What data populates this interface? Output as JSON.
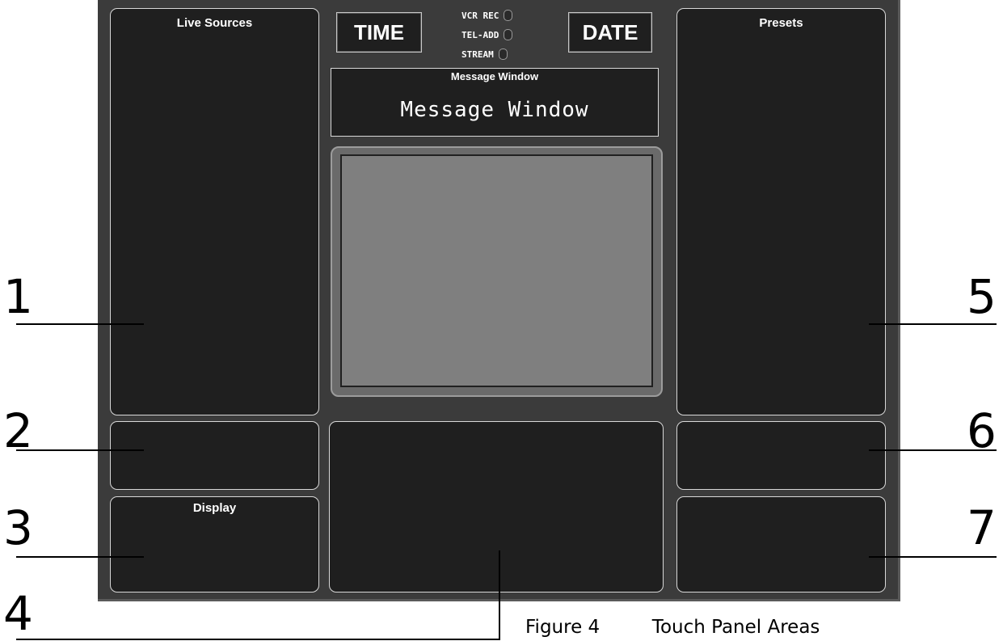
{
  "areas": {
    "live_sources": "Live Sources",
    "presets": "Presets",
    "display": "Display"
  },
  "header": {
    "time_label": "TIME",
    "date_label": "DATE",
    "status": [
      {
        "label": "VCR REC"
      },
      {
        "label": "TEL-ADD"
      },
      {
        "label": "STREAM"
      }
    ]
  },
  "message_window": {
    "title": "Message Window",
    "text": "Message Window"
  },
  "callouts": [
    "1",
    "2",
    "3",
    "4",
    "5",
    "6",
    "7"
  ],
  "caption": {
    "figure": "Figure 4",
    "title": "Touch Panel Areas"
  },
  "colors": {
    "panel_bg": "#3b3b3b",
    "area_bg": "#1f1f1f",
    "screen_bg": "#7f7f7f"
  }
}
